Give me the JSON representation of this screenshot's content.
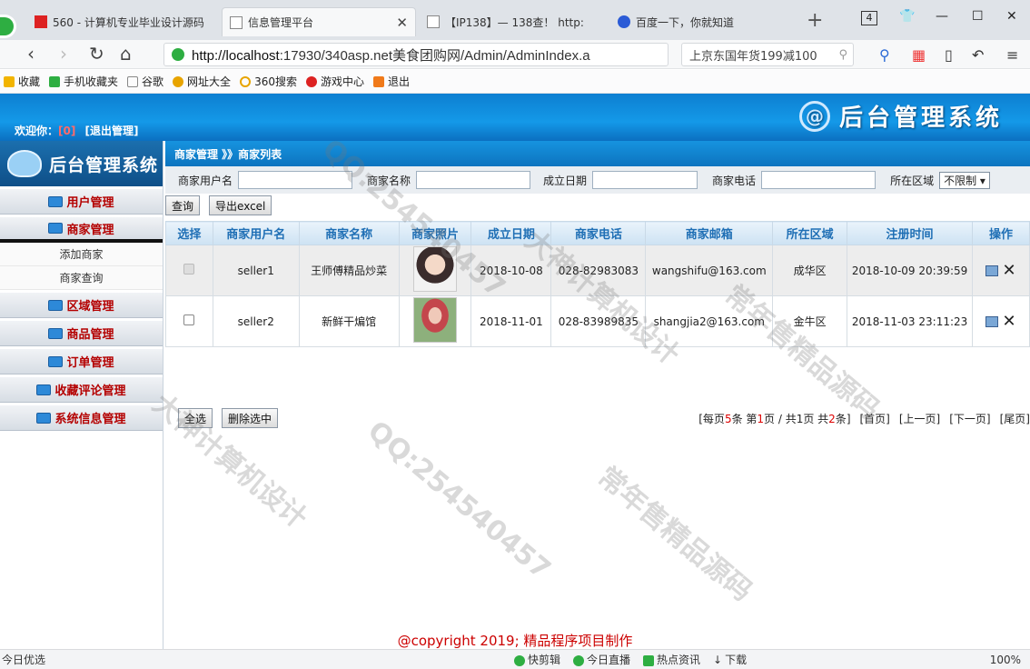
{
  "browser": {
    "tabs": [
      {
        "title": "560 - 计算机专业毕业设计源码"
      },
      {
        "title": "信息管理平台"
      },
      {
        "title": "【IP138】— 138查！ http:"
      },
      {
        "title": "百度一下，你就知道"
      }
    ],
    "tab_count": "4",
    "url_host": "http://localhost",
    "url_rest": ":17930/340asp.net美食团购网/Admin/AdminIndex.a",
    "search_text": "上京东国年货199减100",
    "bookmarks": [
      "收藏",
      "手机收藏夹",
      "谷歌",
      "网址大全",
      "360搜索",
      "游戏中心",
      "退出"
    ]
  },
  "header": {
    "system_title": "后台管理系统",
    "welcome_label": "欢迎你：",
    "username": "[0]",
    "logout": "[退出管理]"
  },
  "sidebar": {
    "title": "后台管理系统",
    "menu": [
      {
        "label": "用户管理"
      },
      {
        "label": "商家管理"
      },
      {
        "label": "区域管理"
      },
      {
        "label": "商品管理"
      },
      {
        "label": "订单管理"
      },
      {
        "label": "收藏评论管理"
      },
      {
        "label": "系统信息管理"
      }
    ],
    "submenu": [
      "添加商家",
      "商家查询"
    ]
  },
  "breadcrumb": "商家管理 》》商家列表",
  "filter": {
    "username_label": "商家用户名",
    "name_label": "商家名称",
    "date_label": "成立日期",
    "phone_label": "商家电话",
    "area_label": "所在区域",
    "area_value": "不限制 ▾",
    "query_button": "查询",
    "export_button": "导出excel"
  },
  "table": {
    "headers": [
      "选择",
      "商家用户名",
      "商家名称",
      "商家照片",
      "成立日期",
      "商家电话",
      "商家邮箱",
      "所在区域",
      "注册时间",
      "操作"
    ],
    "rows": [
      {
        "username": "seller1",
        "name": "王师傅精品炒菜",
        "date": "2018-10-08",
        "phone": "028-82983083",
        "email": "wangshifu@163.com",
        "area": "成华区",
        "reg_time": "2018-10-09 20:39:59"
      },
      {
        "username": "seller2",
        "name": "新鲜干煸馆",
        "date": "2018-11-01",
        "phone": "028-83989835",
        "email": "shangjia2@163.com",
        "area": "金牛区",
        "reg_time": "2018-11-03 23:11:23"
      }
    ]
  },
  "actions": {
    "select_all": "全选",
    "delete_selected": "删除选中"
  },
  "pager": {
    "info_prefix": "[每页",
    "per_page": "5",
    "info_mid1": "条 第",
    "page": "1",
    "info_mid2": "页 / 共1页 共",
    "total": "2",
    "info_suffix": "条]",
    "first": "[首页]",
    "prev": "[上一页]",
    "next": "[下一页]",
    "last": "[尾页]"
  },
  "copyright": "@copyright 2019; 精品程序项目制作",
  "statusbar": {
    "left": "今日优选",
    "items": [
      "快剪辑",
      "今日直播",
      "热点资讯",
      "下载"
    ],
    "zoom": "100%"
  },
  "watermarks": [
    "QQ:254540457",
    "大神计算机设计",
    "常年售精品源码"
  ]
}
